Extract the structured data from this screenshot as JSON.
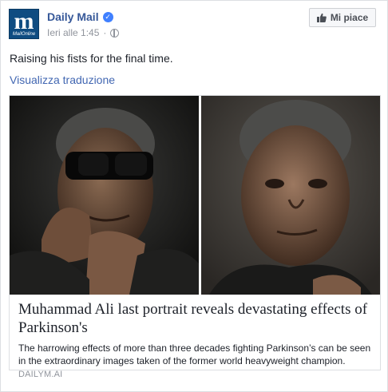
{
  "page": {
    "name": "Daily Mail",
    "avatar_letter": "m",
    "avatar_sub": "MailOnline",
    "timestamp": "Ieri alle 1:45",
    "audience_icon": "globe-icon",
    "verified_icon": "verified-check-icon",
    "like_button": {
      "icon": "thumbs-up-icon",
      "label": "Mi piace"
    }
  },
  "post": {
    "text": "Raising his fists for the final time.",
    "translate_link": "Visualizza traduzione"
  },
  "link_card": {
    "title": "Muhammad Ali last portrait reveals devastating effects of Parkinson's",
    "description": "The harrowing effects of more than three decades fighting Parkinson’s can be seen in the extraordinary images taken of the former world heavyweight champion.",
    "domain": "DAILYM.AI"
  },
  "colors": {
    "link_blue": "#365899",
    "translate_blue": "#4267b2",
    "verified_blue": "#4080ff",
    "avatar_blue": "#0f4c81",
    "meta_gray": "#90949c"
  }
}
